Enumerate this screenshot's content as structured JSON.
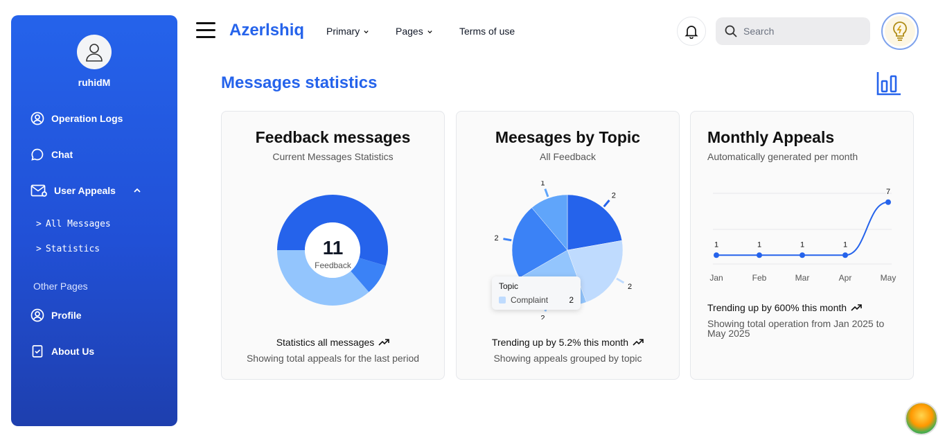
{
  "sidebar": {
    "username": "ruhidM",
    "items": [
      {
        "label": "Operation Logs"
      },
      {
        "label": "Chat"
      },
      {
        "label": "User Appeals"
      }
    ],
    "sub_items": [
      {
        "label": "All Messages"
      },
      {
        "label": "Statistics"
      }
    ],
    "section_label": "Other Pages",
    "other_items": [
      {
        "label": "Profile"
      },
      {
        "label": "About Us"
      }
    ]
  },
  "header": {
    "brand": "Azerlshiq",
    "links": [
      {
        "label": "Primary"
      },
      {
        "label": "Pages"
      },
      {
        "label": "Terms of use"
      }
    ],
    "search_placeholder": "Search"
  },
  "page_title": "Messages statistics",
  "cards": [
    {
      "title": "Feedback messages",
      "subtitle": "Current Messages Statistics",
      "center_value": "11",
      "center_label": "Feedback",
      "foot1": "Statistics all messages",
      "foot2": "Showing total appeals for the last period"
    },
    {
      "title": "Meesages by Topic",
      "subtitle": "All Feedback",
      "tooltip_title": "Topic",
      "tooltip_label": "Complaint",
      "tooltip_value": "2",
      "foot1": "Trending up by 5.2% this month",
      "foot2": "Showing appeals grouped by topic"
    },
    {
      "title": "Monthly Appeals",
      "subtitle": "Automatically generated per month",
      "foot1": "Trending up by 600% this month",
      "foot2": "Showing total operation from Jan 2025 to May 2025"
    }
  ],
  "chart_data": [
    {
      "type": "pie",
      "values": [
        6,
        1,
        4
      ],
      "colors": [
        "#2563eb",
        "#3b82f6",
        "#93c5fd"
      ],
      "center_text": "11",
      "center_label": "Feedback"
    },
    {
      "type": "pie",
      "values": [
        2,
        2,
        2,
        2,
        1
      ],
      "labels": [
        "2",
        "2",
        "2",
        "2",
        "1"
      ],
      "colors": [
        "#2563eb",
        "#bfdbfe",
        "#93c5fd",
        "#3b82f6",
        "#60a5fa"
      ]
    },
    {
      "type": "line",
      "x": [
        "Jan",
        "Feb",
        "Mar",
        "Apr",
        "May"
      ],
      "values": [
        1,
        1,
        1,
        1,
        7
      ],
      "color": "#2563eb"
    }
  ],
  "colors": {
    "accent": "#2563eb",
    "sidebar": "#2563eb"
  }
}
